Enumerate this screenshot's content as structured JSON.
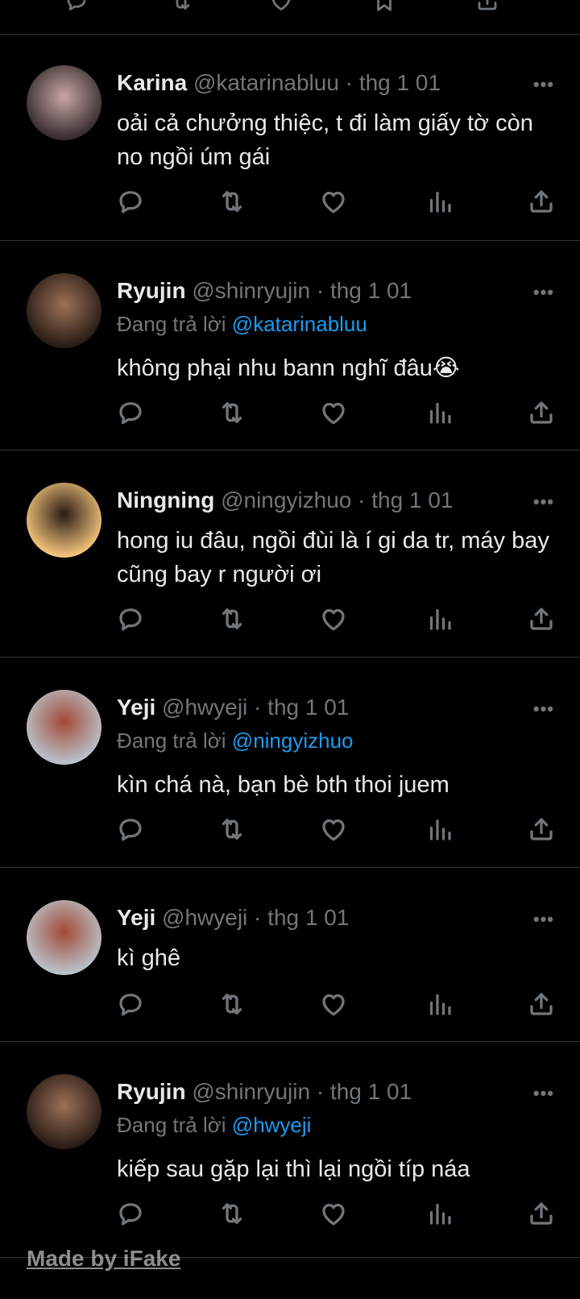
{
  "tweets": [
    {
      "name": "Karina",
      "handle": "@katarinabluu",
      "time": "thg 1 01",
      "reply_prefix": "",
      "reply_to": "",
      "text": "oải cả chưởng thiệc, t đi làm giấy tờ còn no ngồi úm gái",
      "avatar_colors": [
        "#3a2e30",
        "#c7a7a6"
      ]
    },
    {
      "name": "Ryujin",
      "handle": "@shinryujin",
      "time": "thg 1 01",
      "reply_prefix": "Đang trả lời",
      "reply_to": "@katarinabluu",
      "text": "không phại nhu bann nghĩ đâu😭",
      "avatar_colors": [
        "#2a1c16",
        "#9c7259"
      ]
    },
    {
      "name": "Ningning",
      "handle": "@ningyizhuo",
      "time": "thg 1 01",
      "reply_prefix": "",
      "reply_to": "",
      "text": "hong iu đâu, ngồi đùi là í gi da tr, máy bay cũng bay r người ơi",
      "avatar_colors": [
        "#f0c27a",
        "#2a1a14"
      ]
    },
    {
      "name": "Yeji",
      "handle": "@hwyeji",
      "time": "thg 1 01",
      "reply_prefix": "Đang trả lời",
      "reply_to": "@ningyizhuo",
      "text": "kìn chá nà, bạn bè bth thoi juem",
      "avatar_colors": [
        "#b9c0c8",
        "#a24a36"
      ]
    },
    {
      "name": "Yeji",
      "handle": "@hwyeji",
      "time": "thg 1 01",
      "reply_prefix": "",
      "reply_to": "",
      "text": "kì ghê",
      "avatar_colors": [
        "#b9c0c8",
        "#a24a36"
      ]
    },
    {
      "name": "Ryujin",
      "handle": "@shinryujin",
      "time": "thg 1 01",
      "reply_prefix": "Đang trả lời",
      "reply_to": "@hwyeji",
      "text": "kiếp sau gặp lại thì lại ngồi típ náa",
      "avatar_colors": [
        "#2a1c16",
        "#9c7259"
      ]
    }
  ],
  "icons": {
    "reply": "reply-icon",
    "retweet": "retweet-icon",
    "like": "heart-icon",
    "views": "views-icon",
    "share": "share-icon",
    "more": "more-icon"
  },
  "more_label": "•••",
  "separator": " · ",
  "watermark": "Made by iFake",
  "colors": {
    "background": "#000000",
    "text": "#e7e9ea",
    "muted": "#71767b",
    "link": "#1d9bf0",
    "divider": "#2f3336"
  }
}
